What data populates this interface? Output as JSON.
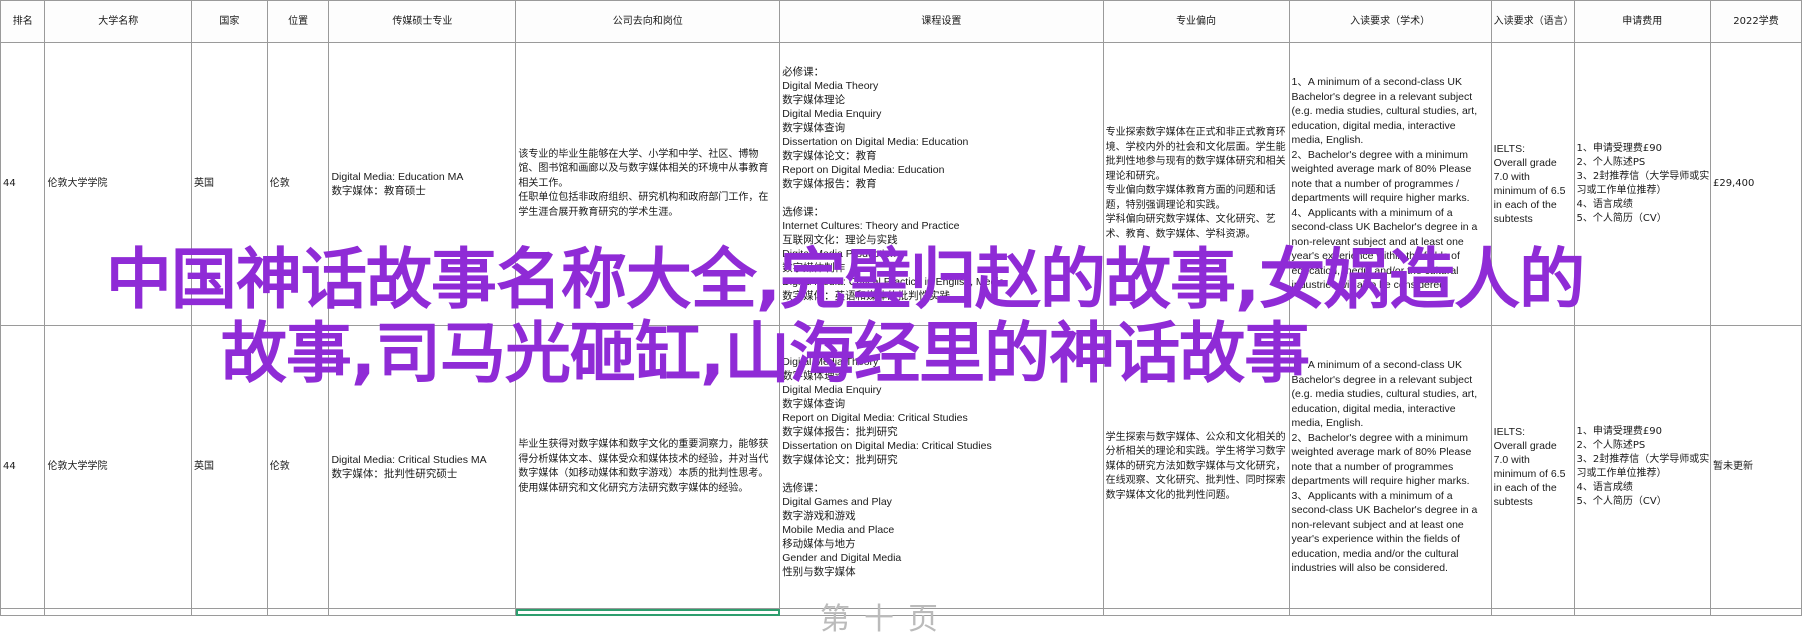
{
  "headers": [
    "排名",
    "大学名称",
    "国家",
    "位置",
    "传媒硕士专业",
    "公司去向和岗位",
    "课程设置",
    "专业偏向",
    "入读要求（学术）",
    "入读要求（语言）",
    "申请费用",
    "2022学费"
  ],
  "rows": [
    {
      "rank": "44",
      "university": "伦敦大学学院",
      "country": "英国",
      "location": "伦敦",
      "program": [
        "Digital Media: Education MA",
        "数字媒体：教育硕士"
      ],
      "careers": "该专业的毕业生能够在大学、小学和中学、社区、博物馆、图书馆和画廊以及与数字媒体相关的环境中从事教育相关工作。\n任职单位包括非政府组织、研究机构和政府部门工作，在学生涯合展开教育研究的学术生涯。",
      "courses": [
        "必修课：",
        "Digital Media Theory",
        "数字媒体理论",
        "Digital Media Enquiry",
        "数字媒体查询",
        "Dissertation on Digital Media: Education",
        "数字媒体论文：教育",
        "Report on Digital Media: Education",
        "数字媒体报告：教育",
        "",
        "选修课：",
        "Internet Cultures: Theory and Practice",
        "互联网文化：理论与实践",
        "Digital Media Production",
        "数字媒体制作",
        "Digital Media: Critical Practice in English, Media",
        "数字媒体：英语和媒体的批判性实践"
      ],
      "focus": "专业探索数字媒体在正式和非正式教育环境、学校内外的社会和文化层面。学生能批判性地参与现有的数字媒体研究和相关理论和研究。\n专业偏向数字媒体教育方面的问题和话题，特别强调理论和实践。\n学科偏向研究数字媒体、文化研究、艺术、教育、数字媒体、学科资源。",
      "academic": "1、A minimum of a second-class UK Bachelor's degree in a relevant subject (e.g. media studies, cultural studies, art, education, digital media, interactive media, English.\n2、Bachelor's degree with a minimum weighted average mark of 80% Please note that a number of programmes / departments will require higher marks.\n4、Applicants with a minimum of a second-class UK Bachelor's degree in a non-relevant subject and at least one year's experience within the fields of education, media and/or the cultural industries will also be considered.",
      "language": [
        "IELTS:",
        "Overall grade",
        "7.0 with",
        "minimum of 6.5",
        "in each of the",
        "subtests"
      ],
      "fee": [
        "1、申请受理费£90",
        "2、个人陈述PS",
        "3、2封推荐信（大学导师或实",
        "习或工作单位推荐）",
        "4、语言成绩",
        "5、个人简历（CV）"
      ],
      "tuition": "£29,400"
    },
    {
      "rank": "44",
      "university": "伦敦大学学院",
      "country": "英国",
      "location": "伦敦",
      "program": [
        "Digital Media: Critical Studies MA",
        "数字媒体：批判性研究硕士"
      ],
      "careers": "毕业生获得对数字媒体和数字文化的重要洞察力，能够获得分析媒体文本、媒体受众和媒体技术的经验，并对当代数字媒体（如移动媒体和数字游戏）本质的批判性思考。使用媒体研究和文化研究方法研究数字媒体的经验。",
      "courses": [
        "Digital Media Theory",
        "数字媒体理论",
        "Digital Media Enquiry",
        "数字媒体查询",
        "Report on Digital Media: Critical Studies",
        "数字媒体报告：批判研究",
        "Dissertation on Digital Media: Critical Studies",
        "数字媒体论文：批判研究",
        "",
        "选修课：",
        "Digital Games and Play",
        "数字游戏和游戏",
        "Mobile Media and Place",
        "移动媒体与地方",
        "Gender and Digital Media",
        "性别与数字媒体"
      ],
      "focus": "学生探索与数字媒体、公众和文化相关的分析相关的理论和实践。学生将学习数字媒体的研究方法如数字媒体与文化研究，在线观察、文化研究、批判性、同时探索数字媒体文化的批判性问题。",
      "academic": "1、A minimum of a second-class UK Bachelor's degree in a relevant subject (e.g. media studies, cultural studies, art, education, digital media, interactive media, English.\n2、Bachelor's degree with a minimum weighted average mark of 80% Please note that a number of programmes departments will require higher marks.\n3、Applicants with a minimum of a second-class UK Bachelor's degree in a non-relevant subject and at least one year's experience within the fields of education, media and/or the cultural industries will also be considered.",
      "language": [
        "IELTS:",
        "Overall grade",
        "7.0 with",
        "minimum of 6.5",
        "in each of the",
        "subtests"
      ],
      "fee": [
        "1、申请受理费£90",
        "2、个人陈述PS",
        "3、2封推荐信（大学导师或实",
        "习或工作单位推荐）",
        "4、语言成绩",
        "5、个人简历（CV）"
      ],
      "tuition": "暂未更新"
    }
  ],
  "overlay": {
    "line1": "中国神话故事名称大全,完璧归赵的故事,女娲造人的",
    "line2": "故事,司马光砸缸,山海经里的神话故事"
  },
  "faded_text": "第十页",
  "colors": {
    "overlay": "#8f2bd6",
    "grid": "#9a9a9a",
    "selection": "#2e9e6e"
  }
}
